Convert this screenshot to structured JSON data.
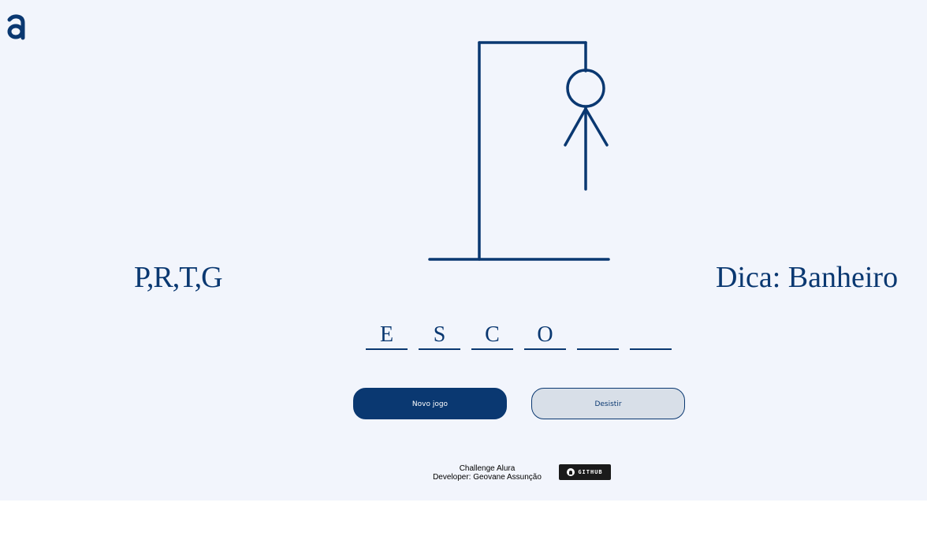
{
  "logo": {
    "glyph": "a",
    "icon": "alura-logo-icon"
  },
  "game": {
    "wrong_letters": "P,R,T,G",
    "hint": "Dica: Banheiro",
    "slots": [
      "E",
      "S",
      "C",
      "O",
      "",
      ""
    ],
    "errors": 4
  },
  "buttons": {
    "new_game": "Novo jogo",
    "give_up": "Desistir"
  },
  "footer": {
    "line1": "Challenge Alura",
    "line2": "Developer: Geovane Assunção",
    "github_label": "GITHUB",
    "github_icon": "github-icon"
  },
  "colors": {
    "primary": "#0a3871",
    "background": "#f2f5fc",
    "secondary_button": "#d8dfe8"
  }
}
